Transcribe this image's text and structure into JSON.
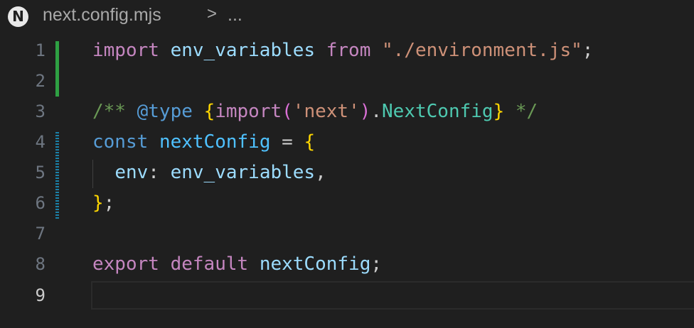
{
  "breadcrumb": {
    "logo_letter": "N",
    "file_name": "next.config.mjs",
    "separator": ">",
    "ellipsis": "..."
  },
  "line_numbers": [
    "1",
    "2",
    "3",
    "4",
    "5",
    "6",
    "7",
    "8",
    "9"
  ],
  "code": {
    "line1": {
      "t1": "import",
      "t2": " ",
      "t3": "env_variables",
      "t4": " ",
      "t5": "from",
      "t6": " ",
      "t7": "\"./environment.js\"",
      "t8": ";"
    },
    "line3": {
      "t1": "/** ",
      "t2": "@type",
      "t3": " ",
      "t4": "{",
      "t5": "import",
      "t6": "(",
      "t7": "'next'",
      "t8": ")",
      "t9": ".",
      "t10": "NextConfig",
      "t11": "}",
      "t12": " */"
    },
    "line4": {
      "t1": "const",
      "t2": " ",
      "t3": "nextConfig",
      "t4": " = ",
      "t5": "{"
    },
    "line5": {
      "t1": "  ",
      "t2": "env",
      "t3": ": ",
      "t4": "env_variables",
      "t5": ","
    },
    "line6": {
      "t1": "}",
      "t2": ";"
    },
    "line8": {
      "t1": "export",
      "t2": " ",
      "t3": "default",
      "t4": " ",
      "t5": "nextConfig",
      "t6": ";"
    }
  },
  "colors": {
    "background": "#1f1f1f",
    "keyword": "#c586c0",
    "storage": "#569cd6",
    "variable": "#9cdcfe",
    "string": "#ce9178",
    "comment": "#6a9955",
    "bracket": "#ffd700",
    "type": "#4ec9b0",
    "gutter_added": "#2ea043",
    "gutter_modified": "#1b81a8"
  }
}
